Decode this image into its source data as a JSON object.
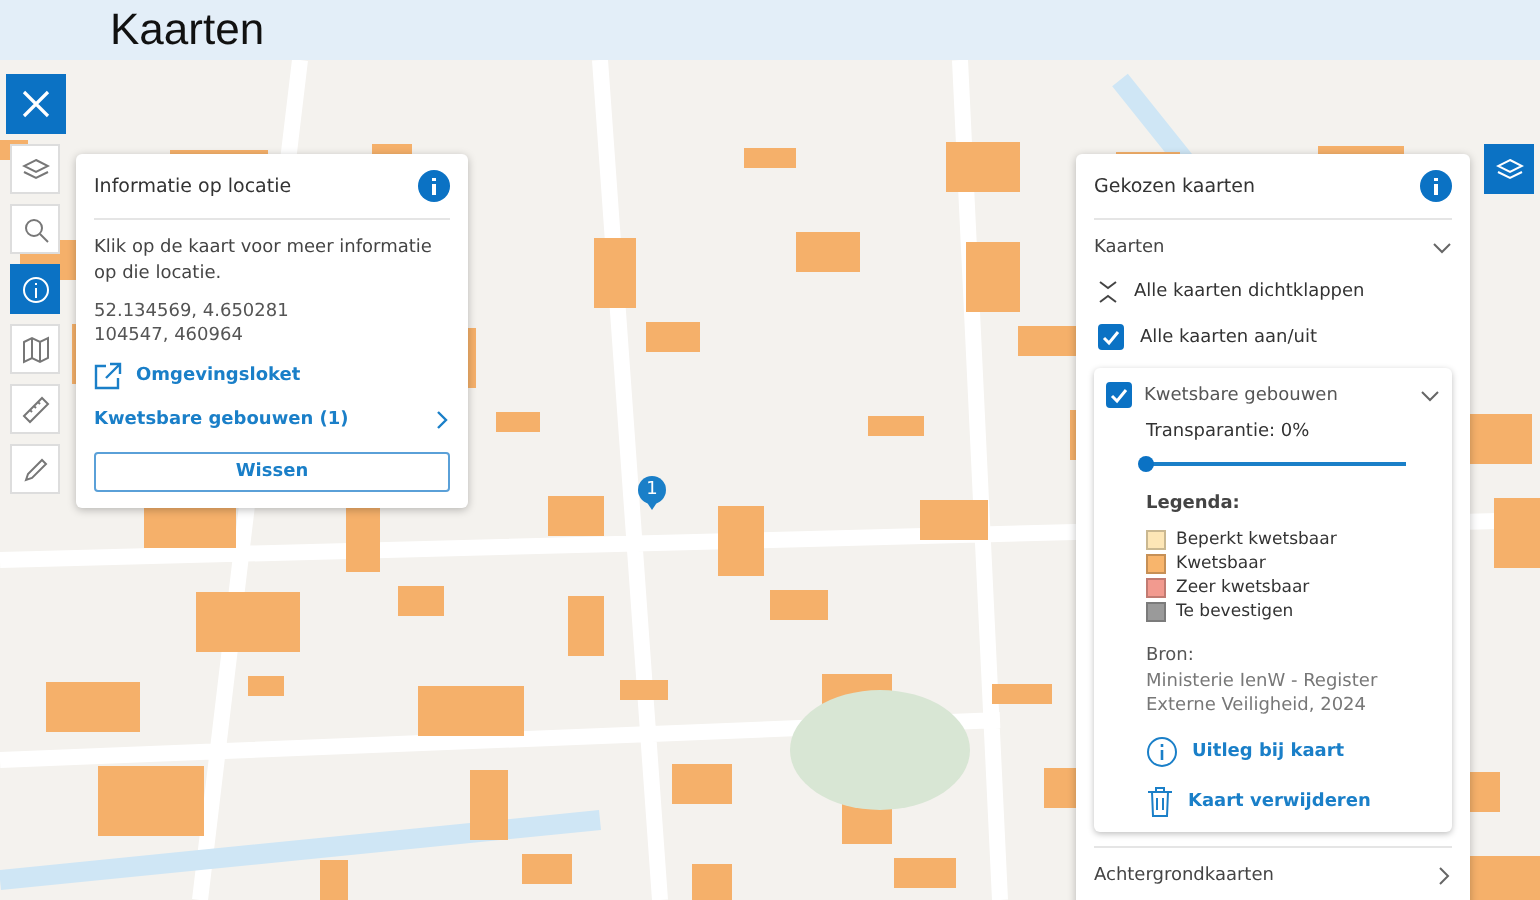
{
  "header": {
    "title": "Kaarten"
  },
  "toolbar": [
    {
      "kind": "layers",
      "selected": false
    },
    {
      "kind": "search",
      "selected": false
    },
    {
      "kind": "info",
      "selected": true
    },
    {
      "kind": "compare",
      "selected": false
    },
    {
      "kind": "measure",
      "selected": false
    },
    {
      "kind": "draw",
      "selected": false
    }
  ],
  "map": {
    "marker": "1"
  },
  "info_panel": {
    "title": "Informatie op locatie",
    "description": "Klik op de kaart voor meer informatie op die locatie.",
    "coordinates": [
      "52.134569, 4.650281",
      "104547, 460964"
    ],
    "link": "Omgevingsloket",
    "result": "Kwetsbare gebouwen (1)",
    "button": "Wissen"
  },
  "maps_panel": {
    "title": "Gekozen kaarten",
    "section": "Kaarten",
    "section_expanded": true,
    "collapse_all": "Alle kaarten dichtklappen",
    "toggle_all": {
      "label": "Alle kaarten aan/uit",
      "checked": true
    },
    "layer": {
      "name": "Kwetsbare gebouwen",
      "checked": true,
      "expanded": true,
      "transparency_label": "Transparantie: 0%",
      "level": 0,
      "legend_title": "Legenda:",
      "legend": [
        {
          "label": "Beperkt kwetsbaar",
          "color": "#fde6b6"
        },
        {
          "label": "Kwetsbaar",
          "color": "#f8b56c"
        },
        {
          "label": "Zeer kwetsbaar",
          "color": "#f29a8f"
        },
        {
          "label": "Te bevestigen",
          "color": "#9a9a9a"
        }
      ],
      "source_title": "Bron:",
      "source": "Ministerie IenW - Register Externe Veiligheid, 2024",
      "explain": "Uitleg bij kaart",
      "remove": "Kaart verwijderen"
    },
    "background_section": "Achtergrondkaarten"
  }
}
